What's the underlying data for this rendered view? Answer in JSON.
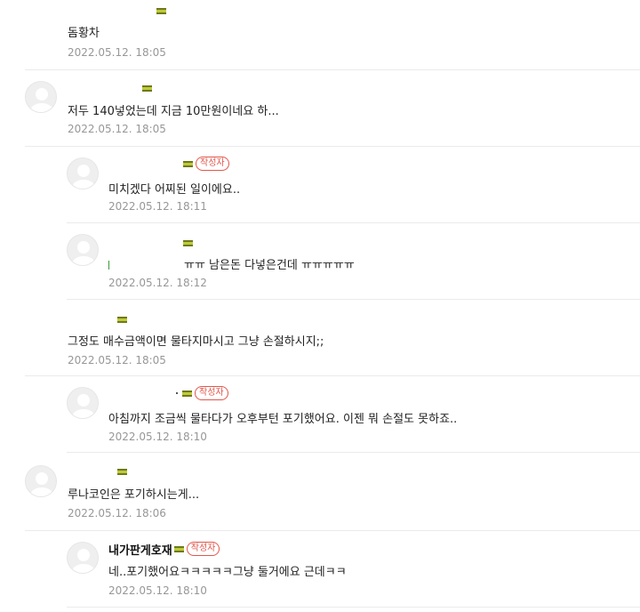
{
  "comments": [
    {
      "text": "돔황차",
      "date": "2022.05.12. 18:05"
    },
    {
      "text": "저두 140넣었는데 지금 10만원이네요 하...",
      "date": "2022.05.12. 18:05"
    },
    {
      "badge": "작성자",
      "text": "미치겠다 어찌된 일이에요..",
      "date": "2022.05.12. 18:11"
    },
    {
      "text": "ㅠㅠ 남은돈 다넣은건데 ㅠㅠㅠㅠㅠ",
      "date": "2022.05.12. 18:12"
    },
    {
      "text": "그정도 매수금액이면 물타지마시고 그냥 손절하시지;;",
      "date": "2022.05.12. 18:05"
    },
    {
      "badge": "작성자",
      "text": "아침까지 조금씩 물타다가 오후부턴 포기했어요. 이젠 뭐 손절도 못하죠..",
      "date": "2022.05.12. 18:10"
    },
    {
      "text": "루나코인은 포기하시는게...",
      "date": "2022.05.12. 18:06"
    },
    {
      "nickname": "내가판게호재",
      "badge": "작성자",
      "text": "네..포기했어요ㅋㅋㅋㅋㅋ그냥 둘거에요 근데ㅋㅋ",
      "date": "2022.05.12. 18:10"
    }
  ]
}
